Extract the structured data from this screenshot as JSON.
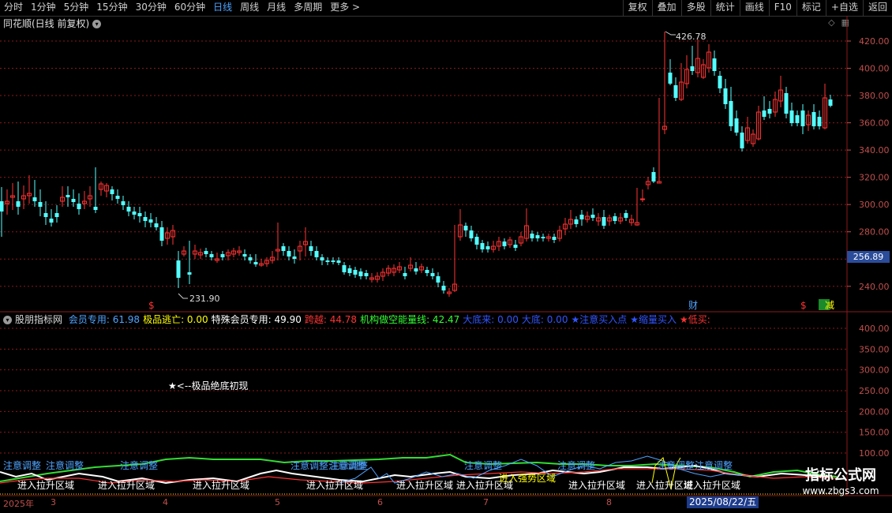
{
  "toolbar": {
    "periods": [
      "分时",
      "1分钟",
      "5分钟",
      "15分钟",
      "30分钟",
      "60分钟",
      "日线",
      "周线",
      "月线",
      "多周期",
      "更多 >"
    ],
    "active_period": "日线",
    "actions": [
      "复权",
      "叠加",
      "多股",
      "统计",
      "画线",
      "F10",
      "标记",
      "+自选",
      "返回"
    ]
  },
  "chart_title": "同花顺(日线 前复权)",
  "price_axis": {
    "ticks": [
      "420.00",
      "400.00",
      "380.00",
      "360.00",
      "340.00",
      "320.00",
      "300.00",
      "280.00",
      "260.00",
      "240.00"
    ],
    "current_price": "256.89"
  },
  "annotations": {
    "high": "426.78",
    "low": "231.90",
    "markers": [
      "$",
      "财",
      "$",
      "减"
    ]
  },
  "indicator": {
    "name": "股朋指标网",
    "items": [
      {
        "label": "会员专用: 61.98",
        "color": "#4fa3ff"
      },
      {
        "label": "极品逃亡: 0.00",
        "color": "#ffff00"
      },
      {
        "label": "特殊会员专用: 49.90",
        "color": "#ffffff"
      },
      {
        "label": "跨越: 44.78",
        "color": "#ff3333"
      },
      {
        "label": "机构做空能量线: 42.47",
        "color": "#33ff33"
      },
      {
        "label": "大底来: 0.00",
        "color": "#3355ff"
      },
      {
        "label": "大底: 0.00",
        "color": "#3355ff"
      },
      {
        "label": "★注意买入点",
        "color": "#3355ff"
      },
      {
        "label": "★缩量买入",
        "color": "#3355ff"
      },
      {
        "label": "★低买:",
        "color": "#ff3333"
      }
    ],
    "axis_ticks": [
      "400.00",
      "350.00",
      "300.00",
      "250.00",
      "200.00",
      "150.00",
      "100.00"
    ],
    "note": "★<--极品绝底初现",
    "labels_attention": [
      "注意调整",
      "注意调整",
      "注意调整",
      "注意调整注意调整",
      "注意调整",
      "注意调整",
      "注意调整",
      "注意调整注意调整"
    ],
    "labels_enter": [
      "进入拉升区域",
      "进入拉升区域",
      "进入拉升区域",
      "进入拉升区域",
      "进入拉升区域",
      "进入拉升区域",
      "进入拉升区域",
      "进入拉升区域",
      "进入拉升区域"
    ],
    "label_strong": "进入强势区域"
  },
  "date_axis": {
    "labels": [
      "2025年",
      "3",
      "4",
      "5",
      "6",
      "7",
      "8"
    ],
    "selected": "2025/08/22/五"
  },
  "watermark": {
    "line1": "指标公式网",
    "line2": "www.zbgs3.com"
  },
  "colors": {
    "up": "#ff3333",
    "down": "#54ffff",
    "grid": "#8b1a1a"
  }
}
